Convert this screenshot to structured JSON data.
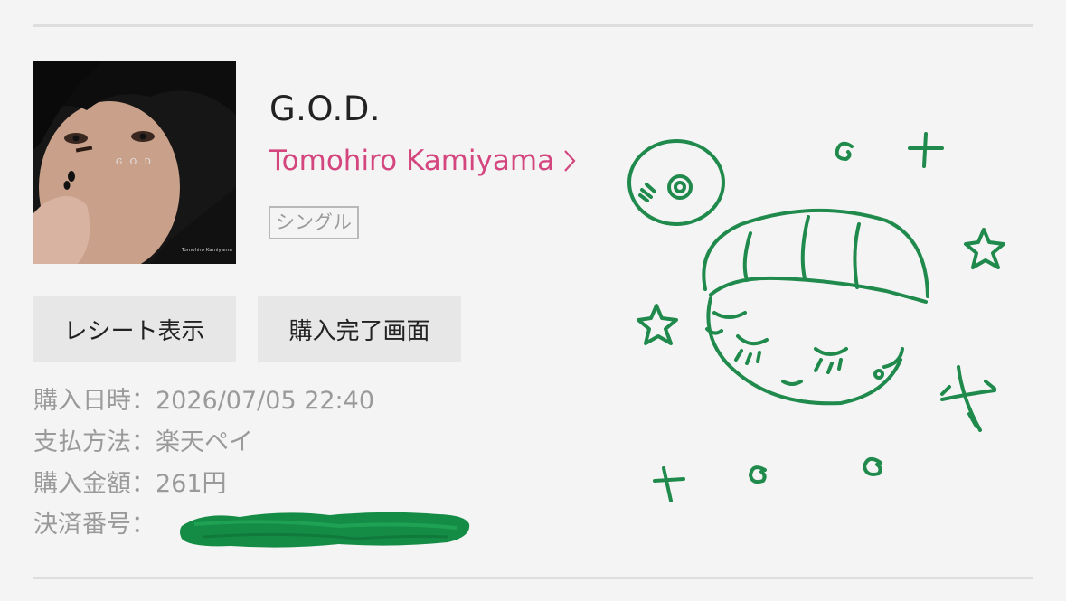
{
  "item": {
    "title": "G.O.D.",
    "artist": "Tomohiro Kamiyama",
    "type_badge": "シングル",
    "cover": {
      "title_text": "G.O.D.",
      "artist_text": "Tomohiro Kamiyama"
    }
  },
  "actions": {
    "receipt_label": "レシート表示",
    "complete_label": "購入完了画面"
  },
  "details": {
    "purchase_datetime": "購入日時：2026/07/05 22:40",
    "payment_method": "支払方法：楽天ペイ",
    "amount": "購入金額：261円",
    "transaction_label": "決済番号："
  },
  "colors": {
    "background": "#f4f4f4",
    "link": "#d4467e",
    "doodle": "#1f8a4c",
    "redaction": "#148c45"
  },
  "icons": [
    "chevron-right-icon"
  ]
}
